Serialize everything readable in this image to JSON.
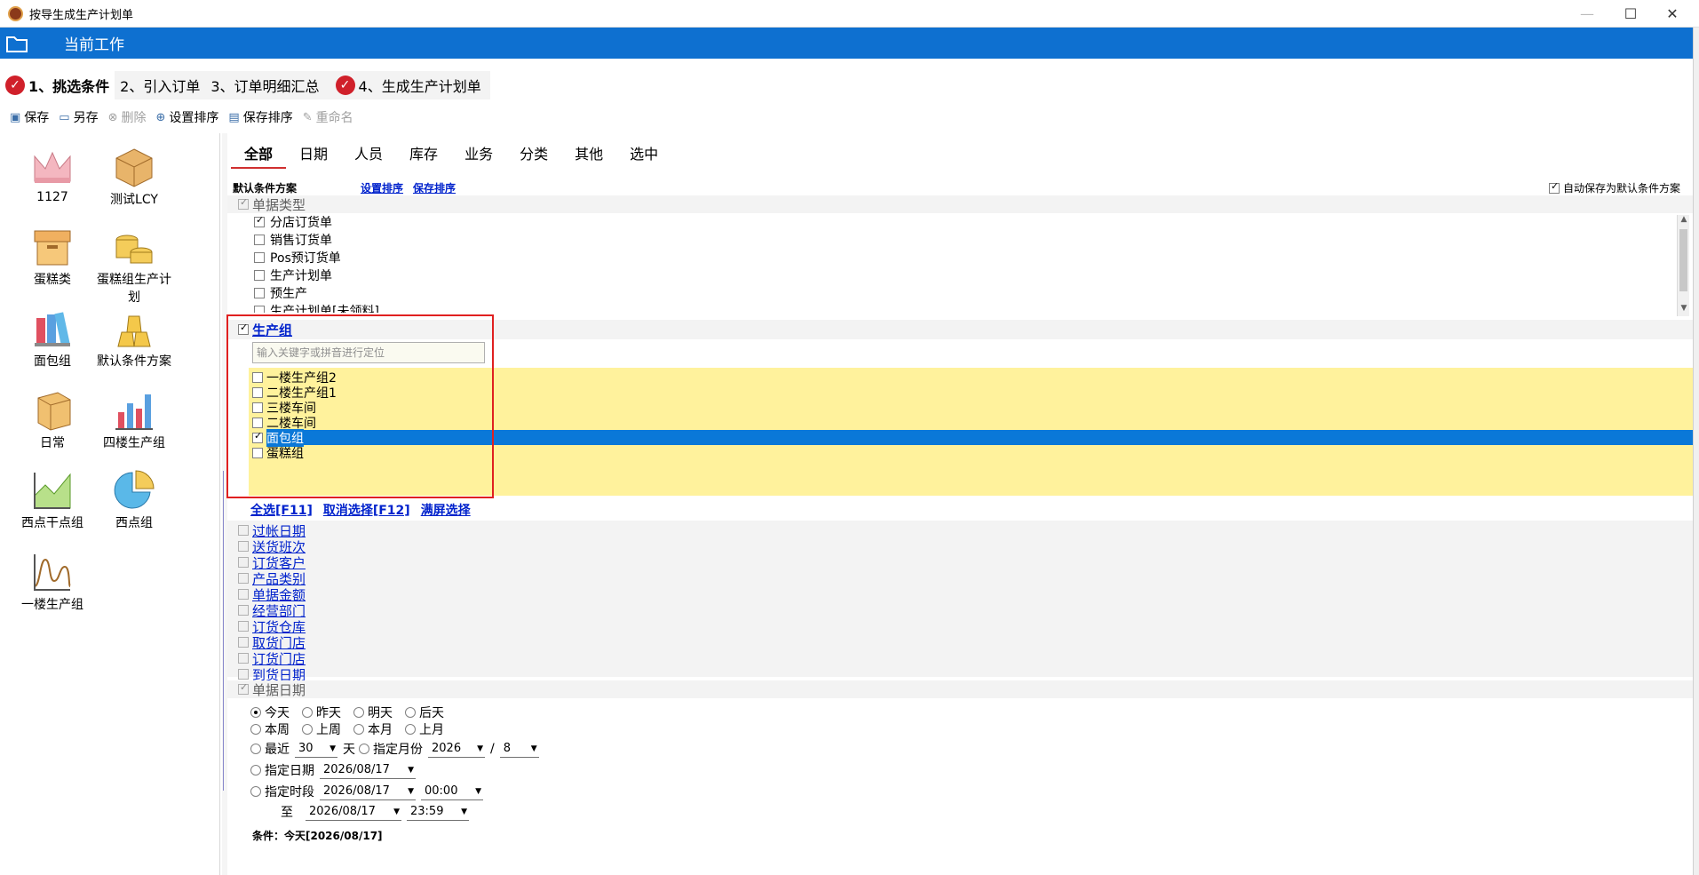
{
  "window": {
    "title": "按导生成生产计划单",
    "min": "—",
    "max": "☐",
    "close": "✕"
  },
  "header": {
    "label": "当前工作"
  },
  "steps": [
    {
      "label": "1、挑选条件",
      "mark": "✓"
    },
    {
      "label": "2、引入订单"
    },
    {
      "label": "3、订单明细汇总"
    },
    {
      "label": "4、生成生产计划单",
      "mark": "✓"
    }
  ],
  "toolbar": {
    "save": "保存",
    "save_as": "另存",
    "delete": "删除",
    "set_sort": "设置排序",
    "save_sort": "保存排序",
    "rename": "重命名"
  },
  "left_items": [
    "1127",
    "测试LCY",
    "蛋糕类",
    "蛋糕组生产计划",
    "面包组",
    "默认条件方案",
    "日常",
    "四楼生产组",
    "西点干点组",
    "西点组",
    "一楼生产组"
  ],
  "tabs": [
    "全部",
    "日期",
    "人员",
    "库存",
    "业务",
    "分类",
    "其他",
    "选中"
  ],
  "scheme": {
    "label": "默认条件方案",
    "set_sort": "设置排序",
    "save_sort": "保存排序",
    "auto_save": "自动保存为默认条件方案"
  },
  "doc_type": {
    "title": "单据类型",
    "items": [
      {
        "label": "分店订货单",
        "checked": true
      },
      {
        "label": "销售订货单",
        "checked": false
      },
      {
        "label": "Pos预订货单",
        "checked": false
      },
      {
        "label": "生产计划单",
        "checked": false
      },
      {
        "label": "预生产",
        "checked": false
      },
      {
        "label": "生产计划单[未领料]",
        "checked": false
      }
    ]
  },
  "prod_group": {
    "title": "生产组",
    "search_placeholder": "输入关键字或拼音进行定位",
    "items": [
      {
        "label": "一楼生产组2",
        "checked": false
      },
      {
        "label": "二楼生产组1",
        "checked": false
      },
      {
        "label": "三楼车间",
        "checked": false
      },
      {
        "label": "二楼车间",
        "checked": false
      },
      {
        "label": "面包组",
        "checked": true
      },
      {
        "label": "蛋糕组",
        "checked": false
      }
    ],
    "select_all": "全选[F11]",
    "deselect": "取消选择[F12]",
    "fullscreen": "满屏选择"
  },
  "criteria": [
    "过帐日期",
    "送货班次",
    "订货客户",
    "产品类别",
    "单据金额",
    "经营部门",
    "订货仓库",
    "取货门店",
    "订货门店",
    "到货日期"
  ],
  "doc_date": {
    "title": "单据日期",
    "today": "今天",
    "yesterday": "昨天",
    "tomorrow": "明天",
    "day_after": "后天",
    "this_week": "本周",
    "last_week": "上周",
    "this_month": "本月",
    "last_month": "上月",
    "recent": "最近",
    "recent_days": "30",
    "day_unit": "天",
    "month_label": "指定月份",
    "year": "2026",
    "slash": "/",
    "month": "8",
    "date_label": "指定日期",
    "date_value": "2026/08/17",
    "range_label": "指定时段",
    "range_from_date": "2026/08/17",
    "range_from_time": "00:00",
    "to_label": "至",
    "range_to_date": "2026/08/17",
    "range_to_time": "23:59",
    "condition": "条件：今天[2026/08/17]"
  }
}
